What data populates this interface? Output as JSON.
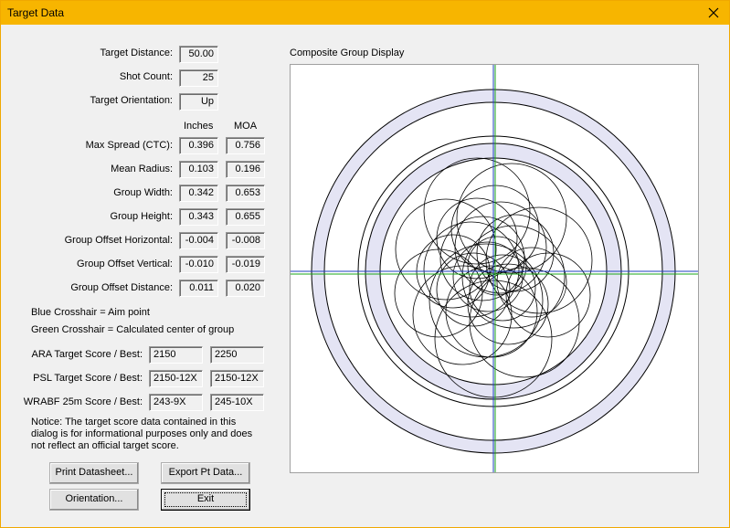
{
  "window": {
    "title": "Target Data"
  },
  "stats": {
    "target_distance": {
      "label": "Target Distance:",
      "value": "50.00"
    },
    "shot_count": {
      "label": "Shot Count:",
      "value": "25"
    },
    "target_orientation": {
      "label": "Target Orientation:",
      "value": "Up"
    }
  },
  "table": {
    "col_inches": "Inches",
    "col_moa": "MOA",
    "rows": [
      {
        "label": "Max Spread (CTC):",
        "inches": "0.396",
        "moa": "0.756"
      },
      {
        "label": "Mean Radius:",
        "inches": "0.103",
        "moa": "0.196"
      },
      {
        "label": "Group Width:",
        "inches": "0.342",
        "moa": "0.653"
      },
      {
        "label": "Group Height:",
        "inches": "0.343",
        "moa": "0.655"
      },
      {
        "label": "Group Offset Horizontal:",
        "inches": "-0.004",
        "moa": "-0.008"
      },
      {
        "label": "Group Offset Vertical:",
        "inches": "-0.010",
        "moa": "-0.019"
      },
      {
        "label": "Group Offset Distance:",
        "inches": "0.011",
        "moa": "0.020"
      }
    ]
  },
  "legend": {
    "blue": "Blue Crosshair = Aim point",
    "green": "Green Crosshair = Calculated center of group"
  },
  "scores": [
    {
      "label": "ARA Target Score / Best:",
      "score": "2150",
      "best": "2250"
    },
    {
      "label": "PSL Target Score / Best:",
      "score": "2150-12X",
      "best": "2150-12X"
    },
    {
      "label": "WRABF 25m Score / Best:",
      "score": "243-9X",
      "best": "245-10X"
    }
  ],
  "notice": {
    "line1": "Notice: The target score data contained in this",
    "line2": "dialog is for informational purposes only and does",
    "line3": "not reflect an official target score."
  },
  "buttons": {
    "print": "Print Datasheet...",
    "export": "Export Pt Data...",
    "orientation": "Orientation...",
    "exit": "Exit"
  },
  "display": {
    "title": "Composite Group Display"
  },
  "colors": {
    "titlebar": "#f7b500",
    "aim_crosshair": "#1f3fbf",
    "center_crosshair": "#1aa51a",
    "ring_fill": "#e4e4f4"
  }
}
